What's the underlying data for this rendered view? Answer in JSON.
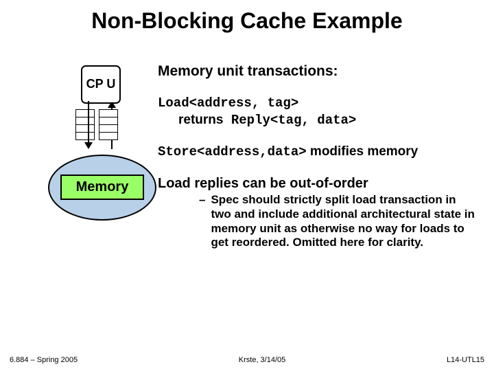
{
  "title": "Non-Blocking Cache Example",
  "diagram": {
    "cpu_label": "CP U",
    "memory_label": "Memory"
  },
  "heading": "Memory unit transactions:",
  "load_sig": "Load<address, tag>",
  "load_returns_prefix": "returns",
  "load_returns_code": " Reply<tag, data>",
  "store_code": "Store<address,data>",
  "store_tail": " modifies memory",
  "reorder": "Load replies can be out-of-order",
  "subnote": "Spec should strictly split load transaction in two and include additional architectural state in memory unit as otherwise no way for loads to get reordered.  Omitted here for clarity.",
  "footer": {
    "left": "6.884 – Spring 2005",
    "center": "Krste, 3/14/05",
    "right": "L14-UTL15"
  }
}
